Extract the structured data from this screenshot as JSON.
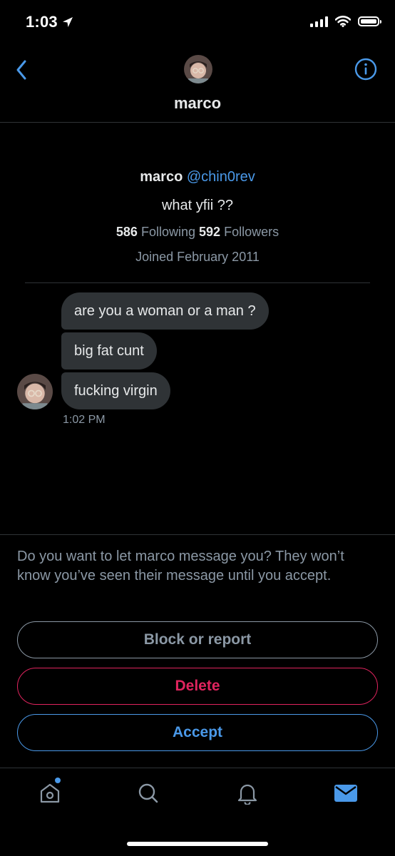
{
  "status_bar": {
    "time": "1:03",
    "icons": [
      "location-arrow-icon",
      "signal-icon",
      "wifi-icon",
      "battery-icon"
    ]
  },
  "header": {
    "title": "marco",
    "back_icon": "chevron-left-icon",
    "info_icon": "info-circle-icon"
  },
  "profile": {
    "name": "marco",
    "handle": "@chin0rev",
    "bio": "what yfii ??",
    "following_count": "586",
    "following_label": "Following",
    "followers_count": "592",
    "followers_label": "Followers",
    "joined": "Joined February 2011"
  },
  "messages": [
    {
      "text": "are you a woman or a man ?"
    },
    {
      "text": "big fat cunt"
    },
    {
      "text": "fucking virgin"
    }
  ],
  "message_time": "1:02 PM",
  "request": {
    "prompt": "Do you want to let marco message you? They won’t know you’ve seen their message until you accept.",
    "block_label": "Block or report",
    "delete_label": "Delete",
    "accept_label": "Accept"
  },
  "bottom_nav": {
    "items": [
      "home-icon",
      "search-icon",
      "bell-icon",
      "mail-icon"
    ],
    "active": "mail-icon"
  },
  "colors": {
    "background": "#000000",
    "accent": "#4a99e9",
    "danger": "#e0245e",
    "muted": "#8b98a5",
    "bubble": "#2f3336"
  }
}
